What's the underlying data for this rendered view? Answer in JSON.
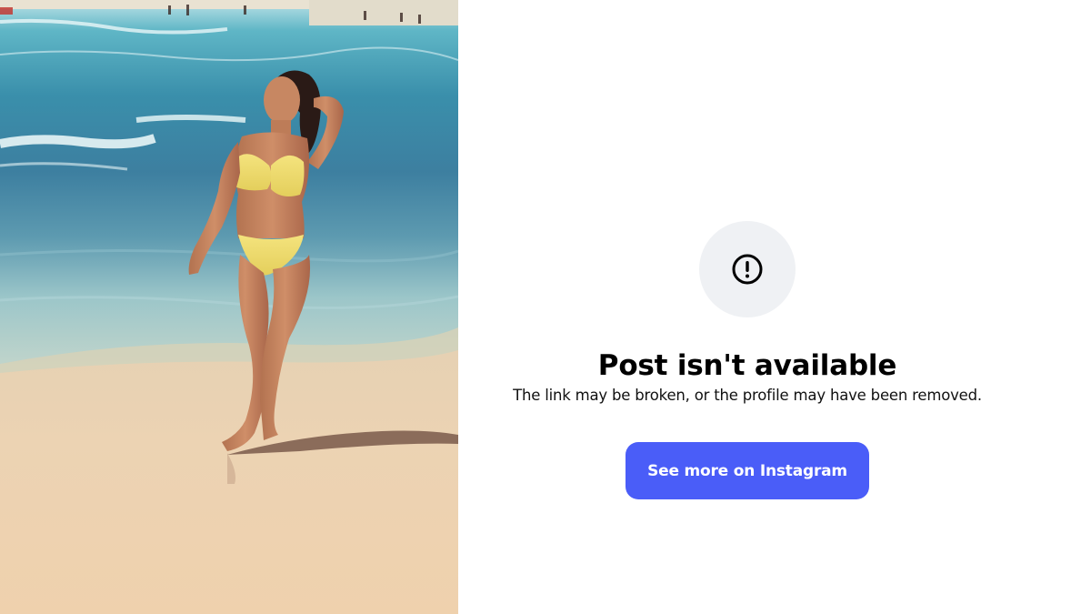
{
  "photo": {
    "icon": "beach-photo"
  },
  "embed": {
    "icon": "alert-circle-icon",
    "title": "Post isn't available",
    "subtitle": "The link may be broken, or the profile may have been removed.",
    "button_label": "See more on Instagram",
    "button_color": "#4a5df8",
    "icon_bg_color": "#eff1f4"
  }
}
